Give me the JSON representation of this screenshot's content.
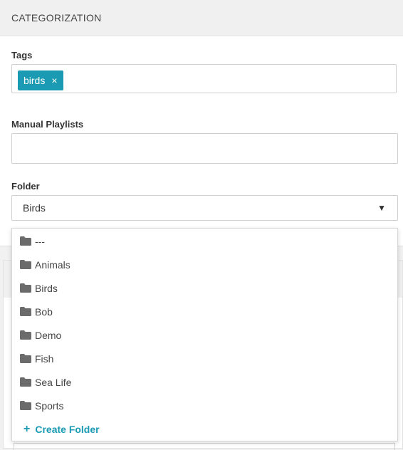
{
  "section": {
    "title": "CATEGORIZATION"
  },
  "tags": {
    "label": "Tags",
    "items": [
      {
        "text": "birds",
        "remove": "×"
      }
    ]
  },
  "playlists": {
    "label": "Manual Playlists",
    "value": ""
  },
  "folder": {
    "label": "Folder",
    "selected": "Birds",
    "caret": "▼",
    "options": [
      "---",
      "Animals",
      "Birds",
      "Bob",
      "Demo",
      "Fish",
      "Sea Life",
      "Sports"
    ],
    "create_label": "Create Folder",
    "create_icon": "+"
  },
  "colors": {
    "accent": "#1a9bb3",
    "header_bg": "#f0f0f0"
  },
  "icons": {
    "option": "folder-icon",
    "create": "plus-icon",
    "remove_tag": "close-icon",
    "caret": "caret-down-icon"
  }
}
